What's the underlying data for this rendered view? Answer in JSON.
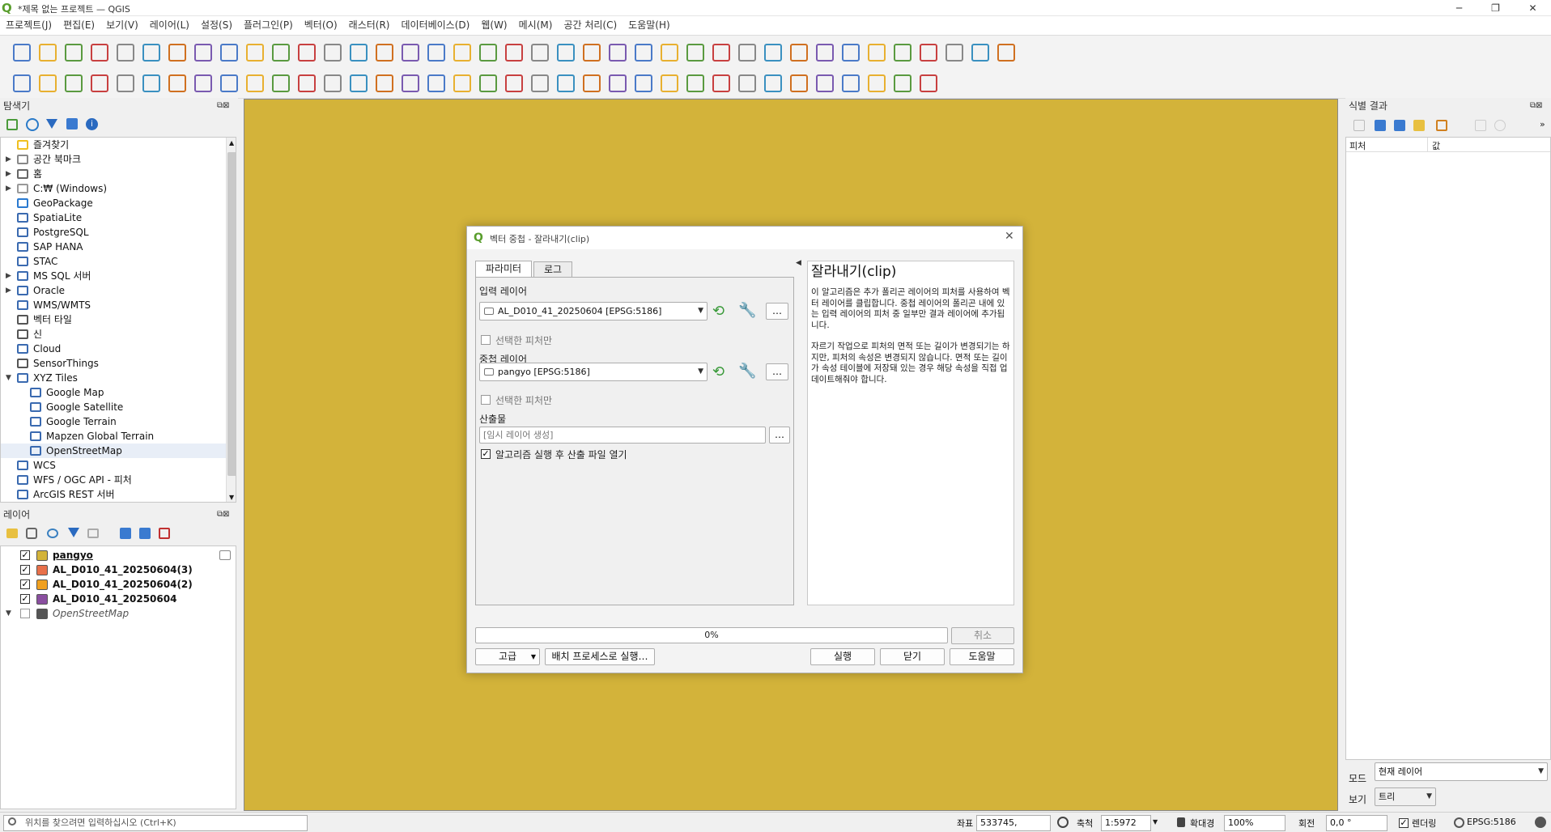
{
  "window": {
    "title": "*제목 없는 프로젝트 — QGIS"
  },
  "menu": [
    "프로젝트(J)",
    "편집(E)",
    "보기(V)",
    "레이어(L)",
    "설정(S)",
    "플러그인(P)",
    "벡터(O)",
    "래스터(R)",
    "데이터베이스(D)",
    "웹(W)",
    "메시(M)",
    "공간 처리(C)",
    "도움말(H)"
  ],
  "browser": {
    "title": "탐색기",
    "items": [
      "즐겨찾기",
      "공간 북마크",
      "홈",
      "C:₩ (Windows)",
      "GeoPackage",
      "SpatiaLite",
      "PostgreSQL",
      "SAP HANA",
      "STAC",
      "MS SQL 서버",
      "Oracle",
      "WMS/WMTS",
      "벡터 타일",
      "신",
      "Cloud",
      "SensorThings",
      "XYZ Tiles",
      "Google Map",
      "Google Satellite",
      "Google Terrain",
      "Mapzen Global Terrain",
      "OpenStreetMap",
      "WCS",
      "WFS / OGC API - 피처",
      "ArcGIS REST 서버"
    ]
  },
  "layers": {
    "title": "레이어",
    "items": [
      {
        "name": "pangyo",
        "color": "#d3b33a",
        "checked": true
      },
      {
        "name": "AL_D010_41_20250604(3)",
        "color": "#e8704a",
        "checked": true
      },
      {
        "name": "AL_D010_41_20250604(2)",
        "color": "#f0a020",
        "checked": true
      },
      {
        "name": "AL_D010_41_20250604",
        "color": "#8a4fa0",
        "checked": true
      },
      {
        "name": "OpenStreetMap",
        "color": "#555555",
        "checked": false
      }
    ]
  },
  "identify": {
    "title": "식별 결과",
    "col_feature": "피처",
    "col_value": "값",
    "mode_label": "모드",
    "mode_value": "현재 레이어",
    "view_label": "보기",
    "view_value": "트리"
  },
  "dialog": {
    "title": "벡터 중첩 - 잘라내기(clip)",
    "tab_params": "파라미터",
    "tab_log": "로그",
    "input_label": "입력 레이어",
    "input_value": "AL_D010_41_20250604 [EPSG:5186]",
    "selected_only": "선택한 피처만",
    "overlay_label": "중첩 레이어",
    "overlay_value": "pangyo [EPSG:5186]",
    "selected_only2": "선택한 피처만",
    "output_label": "산출물",
    "output_placeholder": "[임시 레이어 생성]",
    "open_after": "알고리즘 실행 후 산출 파일 열기",
    "help_title": "잘라내기(clip)",
    "help_p1": "이 알고리즘은 추가 폴리곤 레이어의 피처를 사용하여 벡터 레이어를 클립합니다. 중첩 레이어의 폴리곤 내에 있는 입력 레이어의 피처 중 일부만 결과 레이어에 추가됩니다.",
    "help_p2": "자르기 작업으로 피처의 면적 또는 길이가 변경되기는 하지만, 피처의 속성은 변경되지 않습니다. 면적 또는 길이가 속성 테이블에 저장돼 있는 경우 해당 속성을 직접 업데이트해줘야 합니다.",
    "progress_text": "0%",
    "progress": 0,
    "cancel": "취소",
    "advanced": "고급",
    "batch": "배치 프로세스로 실행…",
    "run": "실행",
    "close": "닫기",
    "help": "도움말",
    "more": "…"
  },
  "statusbar": {
    "locate_placeholder": "위치를 찾으려면 입력하십시오 (Ctrl+K)",
    "coord_label": "좌표",
    "coord_value": "533745, 209200",
    "scale_label": "축척",
    "scale_value": "1:5972",
    "magnifier_label": "확대경",
    "magnifier_value": "100%",
    "rotation_label": "회전",
    "rotation_value": "0,0 °",
    "render_label": "렌더링",
    "crs": "EPSG:5186"
  }
}
